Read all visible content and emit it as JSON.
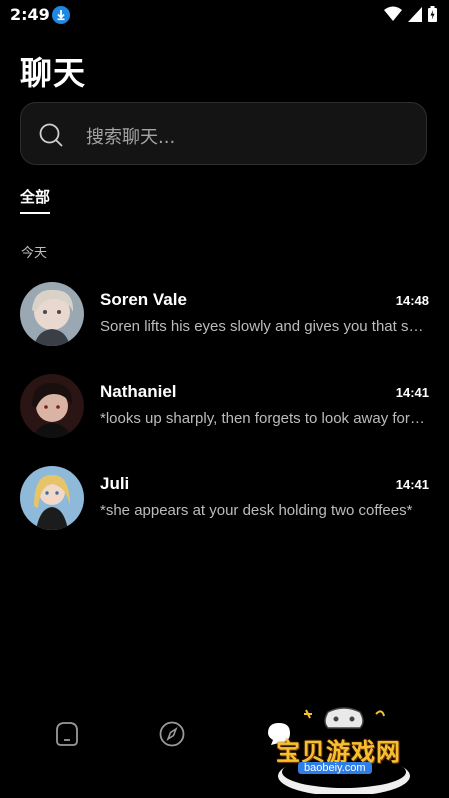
{
  "status_bar": {
    "time": "2:49"
  },
  "header": {
    "title": "聊天"
  },
  "search": {
    "placeholder": "搜索聊天..."
  },
  "tabs": [
    {
      "label": "全部",
      "selected": true
    }
  ],
  "section": {
    "label": "今天"
  },
  "chats": [
    {
      "name": "Soren Vale",
      "time": "14:48",
      "preview": "Soren lifts his eyes slowly and gives you that small smile."
    },
    {
      "name": "Nathaniel",
      "time": "14:41",
      "preview": "*looks up sharply, then forgets to look away for a moment*"
    },
    {
      "name": "Juli",
      "time": "14:41",
      "preview": "*she appears at your desk holding two coffees*"
    }
  ],
  "bottom_nav": {
    "items": [
      "home-icon",
      "compass-icon",
      "chat-icon"
    ]
  },
  "watermark": {
    "title": "宝贝游戏网",
    "url": "baobeiy.com"
  },
  "colors": {
    "background": "#000000",
    "search_bg": "#141414",
    "muted_text": "#bcbcbc",
    "watermark_gold": "#f6c131"
  }
}
